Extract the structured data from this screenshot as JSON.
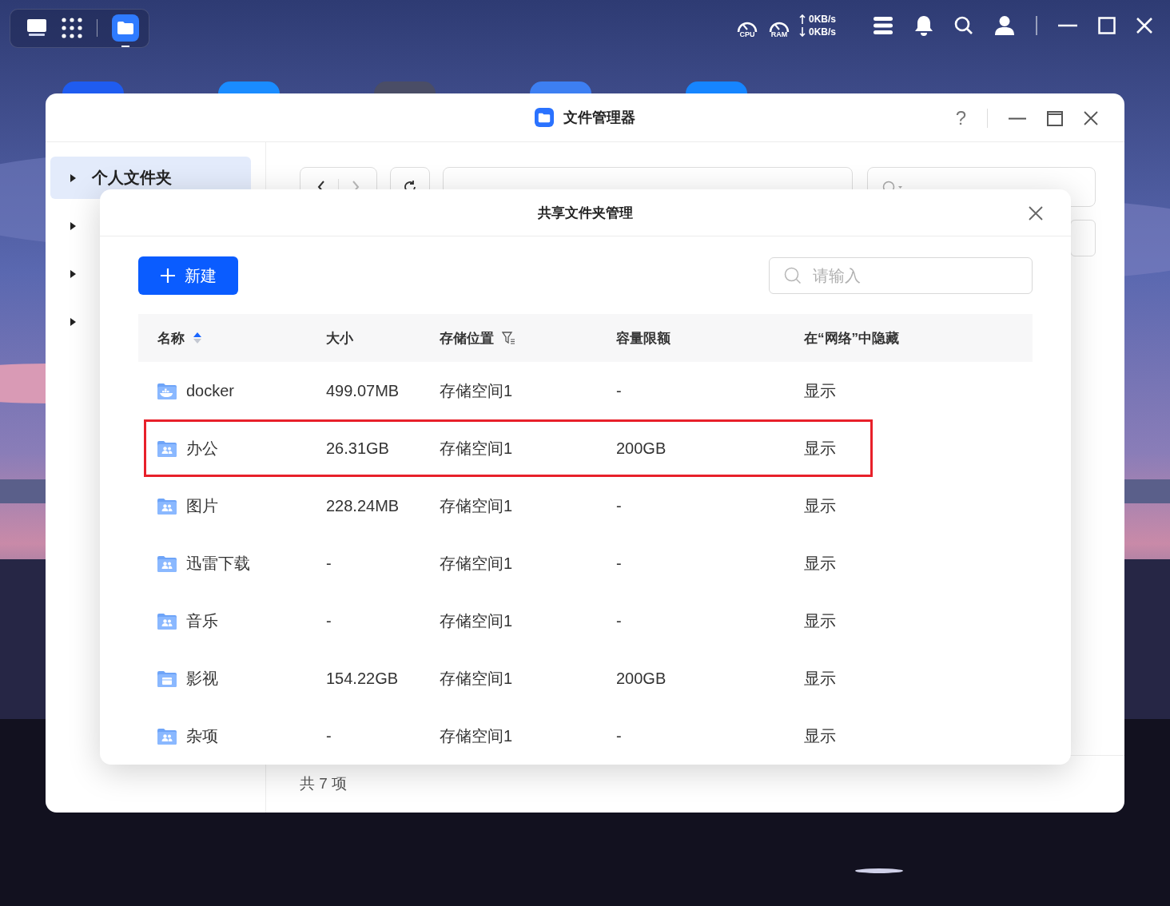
{
  "top_bar": {
    "cpu_label": "CPU",
    "ram_label": "RAM",
    "upload_speed": "0KB/s",
    "download_speed": "0KB/s"
  },
  "dock": {
    "apps": [
      {
        "kind": "desktop",
        "selected": false
      },
      {
        "kind": "launcher",
        "selected": false
      },
      {
        "kind": "files",
        "selected": true
      }
    ]
  },
  "desktop_icons": [
    {
      "color": "#1f5cf0"
    },
    {
      "color": "#1a8cff"
    },
    {
      "color": "#4a4d66"
    },
    {
      "color": "#3d7ff2"
    },
    {
      "color": "#1685ff"
    }
  ],
  "window": {
    "title": "文件管理器",
    "help": "?"
  },
  "sidebar": {
    "items": [
      {
        "label": "个人文件夹",
        "selected": true
      },
      {
        "selected": false
      },
      {
        "selected": false
      },
      {
        "selected": false
      }
    ]
  },
  "status_bar": "共 7 项",
  "dialog": {
    "title": "共享文件夹管理",
    "new_button": "新建",
    "search_placeholder": "请输入",
    "table": {
      "columns": [
        {
          "label": "名称",
          "sorted": true,
          "filter": false
        },
        {
          "label": "大小",
          "sorted": false,
          "filter": false
        },
        {
          "label": "存储位置",
          "sorted": false,
          "filter": true
        },
        {
          "label": "容量限额",
          "sorted": false,
          "filter": false
        },
        {
          "label": "在“网络”中隐藏",
          "sorted": false,
          "filter": false
        }
      ],
      "rows": [
        {
          "kind": "docker",
          "name": "docker",
          "size": "499.07MB",
          "location": "存储空间1",
          "quota": "-",
          "network_visibility": "显示",
          "highlighted": false
        },
        {
          "kind": "shared",
          "name": "办公",
          "size": "26.31GB",
          "location": "存储空间1",
          "quota": "200GB",
          "network_visibility": "显示",
          "highlighted": true
        },
        {
          "kind": "shared",
          "name": "图片",
          "size": "228.24MB",
          "location": "存储空间1",
          "quota": "-",
          "network_visibility": "显示",
          "highlighted": false
        },
        {
          "kind": "shared",
          "name": "迅雷下载",
          "size": "-",
          "location": "存储空间1",
          "quota": "-",
          "network_visibility": "显示",
          "highlighted": false
        },
        {
          "kind": "shared",
          "name": "音乐",
          "size": "-",
          "location": "存储空间1",
          "quota": "-",
          "network_visibility": "显示",
          "highlighted": false
        },
        {
          "kind": "media",
          "name": "影视",
          "size": "154.22GB",
          "location": "存储空间1",
          "quota": "200GB",
          "network_visibility": "显示",
          "highlighted": false
        },
        {
          "kind": "shared",
          "name": "杂项",
          "size": "-",
          "location": "存储空间1",
          "quota": "-",
          "network_visibility": "显示",
          "highlighted": false
        }
      ]
    }
  }
}
